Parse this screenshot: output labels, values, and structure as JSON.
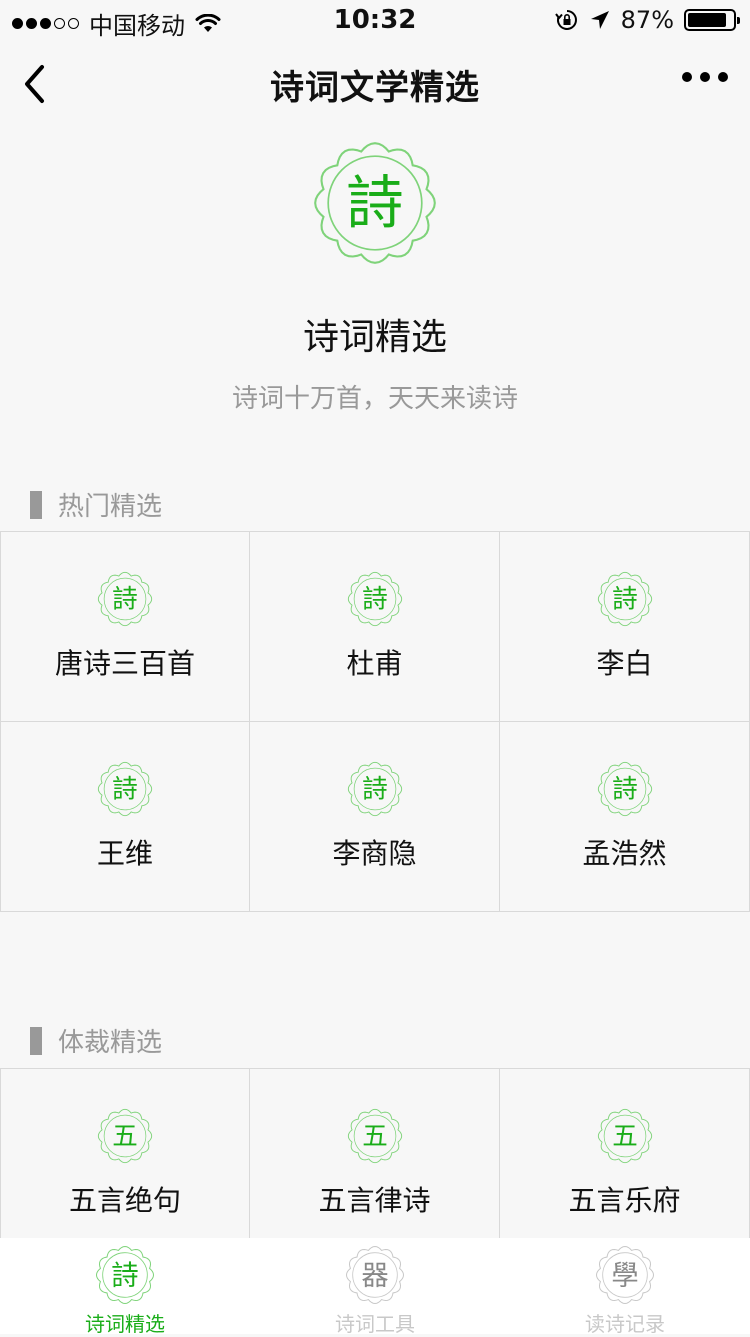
{
  "status_bar": {
    "carrier": "中国移动",
    "time": "10:32",
    "battery_percent": "87%",
    "battery_level": 0.87,
    "icons": [
      "signal-dots",
      "wifi-icon",
      "rotation-lock-icon",
      "location-arrow-icon",
      "battery-icon"
    ]
  },
  "nav": {
    "title": "诗词文学精选",
    "back_icon": "chevron-left-icon",
    "more_icon": "more-dots-icon"
  },
  "hero": {
    "logo_char": "詩",
    "name": "诗词精选",
    "subtitle": "诗词十万首，天天来读诗"
  },
  "sections": [
    {
      "title": "热门精选",
      "items": [
        {
          "char": "詩",
          "label": "唐诗三百首"
        },
        {
          "char": "詩",
          "label": "杜甫"
        },
        {
          "char": "詩",
          "label": "李白"
        },
        {
          "char": "詩",
          "label": "王维"
        },
        {
          "char": "詩",
          "label": "李商隐"
        },
        {
          "char": "詩",
          "label": "孟浩然"
        }
      ]
    },
    {
      "title": "体裁精选",
      "items": [
        {
          "char": "五",
          "label": "五言绝句"
        },
        {
          "char": "五",
          "label": "五言律诗"
        },
        {
          "char": "五",
          "label": "五言乐府"
        }
      ]
    }
  ],
  "tabs": [
    {
      "char": "詩",
      "label": "诗词精选",
      "active": true
    },
    {
      "char": "器",
      "label": "诗词工具",
      "active": false
    },
    {
      "char": "學",
      "label": "读诗记录",
      "active": false
    }
  ],
  "colors": {
    "accent": "#1aad19",
    "seal_ring": "#7fd37a",
    "inactive": "#aaaaaa",
    "muted_text": "#999999",
    "background": "#f7f7f7"
  }
}
